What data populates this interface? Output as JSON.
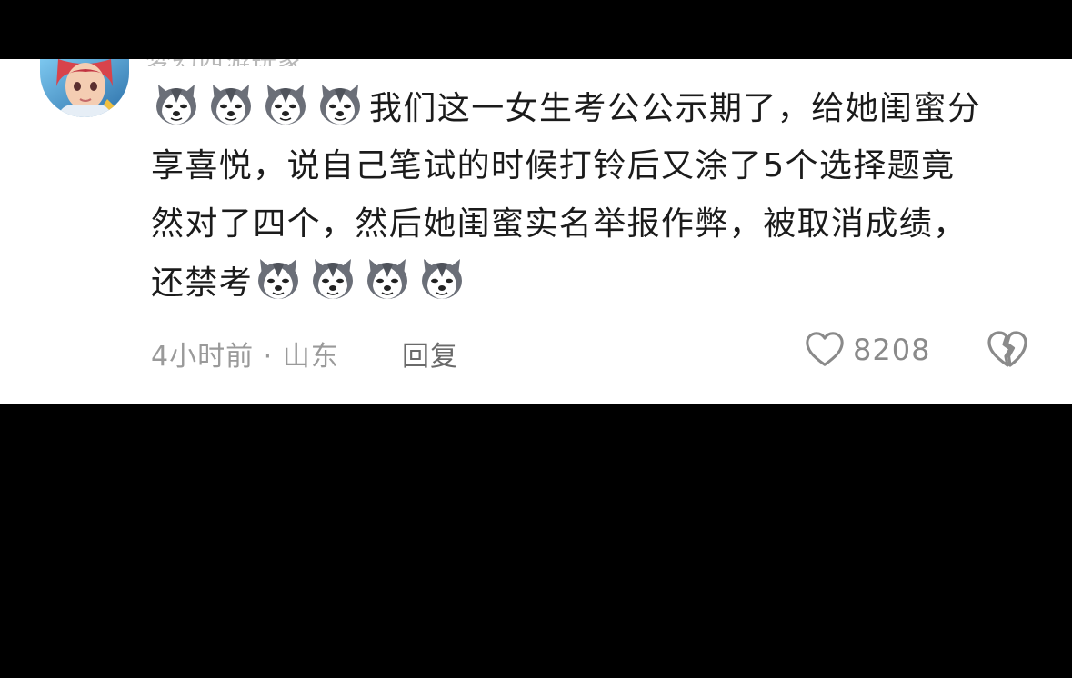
{
  "comment": {
    "username": "梦幻西游玩家",
    "line1": "我们这一女生考公公示期了，给她闺蜜分",
    "line2": "享喜悦，说自己笔试的时候打铃后又涂了5个选择题竟",
    "line3": "然对了四个，然后她闺蜜实名举报作弊，被取消成绩，",
    "line4": "还禁考",
    "emoji_icon": "husky-dog-face-emoji",
    "emoji_count_start": 4,
    "emoji_count_end": 4
  },
  "footer": {
    "time_location": "4小时前 · 山东",
    "reply_label": "回复",
    "like_count": "8208"
  },
  "colors": {
    "background": "#000000",
    "card": "#ffffff",
    "text": "#1b1b1b",
    "meta": "#9a9a9a"
  }
}
